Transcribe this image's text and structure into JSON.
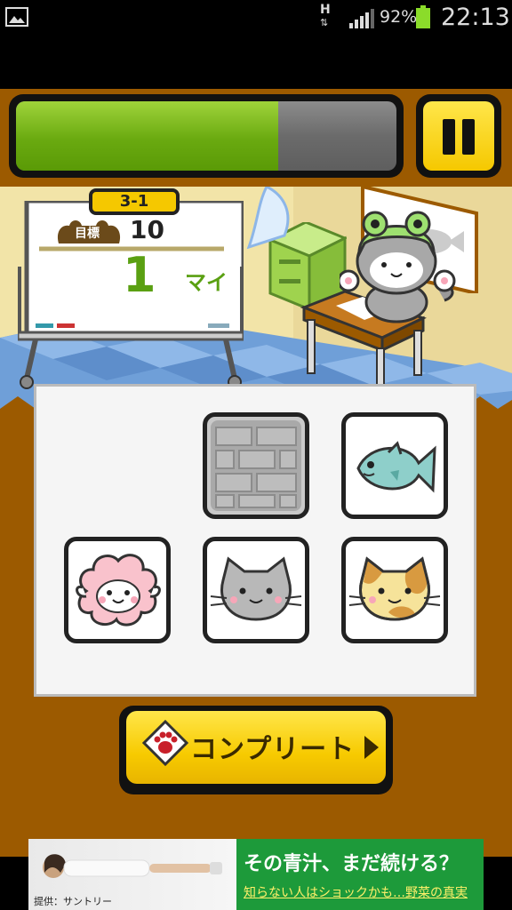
{
  "status_bar": {
    "network": "H",
    "battery_percent": "92%",
    "time": "22:13",
    "icons": [
      "gallery-icon",
      "data-arrows-icon",
      "signal-icon",
      "battery-icon"
    ]
  },
  "game": {
    "progress_fraction": 0.69,
    "stage": "3-1",
    "goal_label": "目標",
    "goal_value": "10",
    "current_count": "1",
    "count_unit": "マイ",
    "complete_label": "コンプリート",
    "tiles": [
      {
        "row": 1,
        "col": 1,
        "kind": "empty"
      },
      {
        "row": 1,
        "col": 2,
        "kind": "brick-wall"
      },
      {
        "row": 1,
        "col": 3,
        "kind": "fish"
      },
      {
        "row": 2,
        "col": 1,
        "kind": "sheep"
      },
      {
        "row": 2,
        "col": 2,
        "kind": "gray-cat"
      },
      {
        "row": 2,
        "col": 3,
        "kind": "calico-cat"
      }
    ],
    "colors": {
      "frame_brown": "#9c5a00",
      "progress_green": "#6aaa10",
      "button_yellow": "#f7ca00",
      "count_green": "#5aa012"
    }
  },
  "ad": {
    "sponsor": "提供：サントリー",
    "headline": "その青汁、まだ続ける？",
    "subline": "知らない人はショックかも…野菜の真実"
  }
}
